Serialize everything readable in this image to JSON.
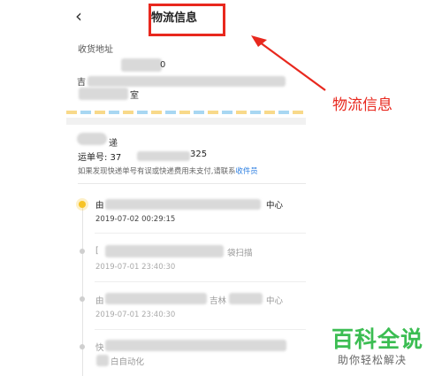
{
  "header": {
    "back_icon": "chevron-left-icon",
    "back_glyph": "‹",
    "title": "物流信息"
  },
  "address": {
    "label": "收货地址",
    "line1_visible_end": "0",
    "line2_visible_start": "吉",
    "line3_visible_end": "室"
  },
  "shipment": {
    "company_visible_end": "递",
    "waybill_label": "运单号: 37",
    "waybill_end": "325",
    "notice_text": "如果发现快递单号有误或快递费用未支付,请联系",
    "notice_link": "收件员"
  },
  "timeline": [
    {
      "text_start": "由",
      "text_end": "中心",
      "time": "2019-07-02 00:29:15",
      "active": true
    },
    {
      "text_start": "[",
      "text_end": "袋扫描",
      "time": "2019-07-01 23:40:30",
      "active": false
    },
    {
      "text_start": "由",
      "text_middle": "吉林",
      "text_end": "中心",
      "time": "2019-07-01 23:40:30",
      "active": false
    },
    {
      "text_start": "快",
      "text_end": "白自动化",
      "time": "",
      "active": false
    }
  ],
  "annotation": {
    "label": "物流信息",
    "color": "#e8281e"
  },
  "watermark": {
    "main": "百科全说",
    "sub": "助你轻松解决"
  },
  "colors": {
    "accent_yellow": "#f7c325",
    "link_blue": "#2a7de1",
    "annotation_red": "#e8281e",
    "watermark_green": "#3bbd52"
  }
}
